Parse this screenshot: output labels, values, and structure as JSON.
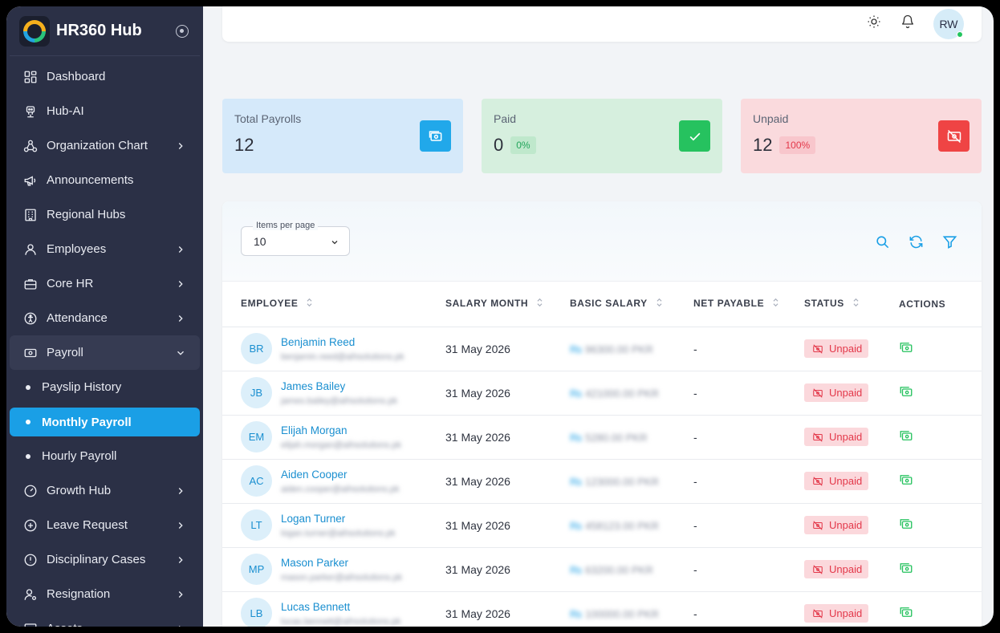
{
  "brand": {
    "name": "HR360 Hub"
  },
  "sidebar": {
    "items": [
      {
        "label": "Dashboard",
        "icon": "dashboard-icon",
        "chevron": false
      },
      {
        "label": "Hub-AI",
        "icon": "robot-icon",
        "chevron": false
      },
      {
        "label": "Organization Chart",
        "icon": "org-chart-icon",
        "chevron": true
      },
      {
        "label": "Announcements",
        "icon": "megaphone-icon",
        "chevron": false
      },
      {
        "label": "Regional Hubs",
        "icon": "building-icon",
        "chevron": false
      },
      {
        "label": "Employees",
        "icon": "user-icon",
        "chevron": true
      },
      {
        "label": "Core HR",
        "icon": "briefcase-icon",
        "chevron": true
      },
      {
        "label": "Attendance",
        "icon": "accessibility-icon",
        "chevron": true
      },
      {
        "label": "Payroll",
        "icon": "money-icon",
        "chevron": true,
        "open": true
      },
      {
        "label": "Growth Hub",
        "icon": "gauge-icon",
        "chevron": true
      },
      {
        "label": "Leave Request",
        "icon": "plus-circle-icon",
        "chevron": true
      },
      {
        "label": "Disciplinary Cases",
        "icon": "alert-circle-icon",
        "chevron": true
      },
      {
        "label": "Resignation",
        "icon": "user-settings-icon",
        "chevron": true
      },
      {
        "label": "Assets",
        "icon": "monitor-icon",
        "chevron": true
      }
    ],
    "payroll_sub": [
      {
        "label": "Payslip History",
        "active": false
      },
      {
        "label": "Monthly Payroll",
        "active": true
      },
      {
        "label": "Hourly Payroll",
        "active": false
      }
    ]
  },
  "topbar": {
    "avatar_initials": "RW"
  },
  "cards": {
    "total": {
      "title": "Total Payrolls",
      "value": "12"
    },
    "paid": {
      "title": "Paid",
      "value": "0",
      "badge": "0%"
    },
    "unpaid": {
      "title": "Unpaid",
      "value": "12",
      "badge": "100%"
    }
  },
  "table_controls": {
    "items_per_page_label": "Items per page",
    "items_per_page_value": "10"
  },
  "table": {
    "columns": [
      "EMPLOYEE",
      "SALARY MONTH",
      "BASIC SALARY",
      "NET PAYABLE",
      "STATUS",
      "ACTIONS"
    ],
    "rows": [
      {
        "initials": "BR",
        "name": "Benjamin Reed",
        "email": "benjamin.reed@aihsolutions.pk",
        "month": "31 May 2026",
        "salary": "96300.00 PKR",
        "net": "-",
        "status": "Unpaid"
      },
      {
        "initials": "JB",
        "name": "James Bailey",
        "email": "james.bailey@aihsolutions.pk",
        "month": "31 May 2026",
        "salary": "421000.00 PKR",
        "net": "-",
        "status": "Unpaid"
      },
      {
        "initials": "EM",
        "name": "Elijah Morgan",
        "email": "elijah.morgan@aihsolutions.pk",
        "month": "31 May 2026",
        "salary": "5280.00 PKR",
        "net": "-",
        "status": "Unpaid"
      },
      {
        "initials": "AC",
        "name": "Aiden Cooper",
        "email": "aiden.cooper@aihsolutions.pk",
        "month": "31 May 2026",
        "salary": "123000.00 PKR",
        "net": "-",
        "status": "Unpaid"
      },
      {
        "initials": "LT",
        "name": "Logan Turner",
        "email": "logan.turner@aihsolutions.pk",
        "month": "31 May 2026",
        "salary": "458123.00 PKR",
        "net": "-",
        "status": "Unpaid"
      },
      {
        "initials": "MP",
        "name": "Mason Parker",
        "email": "mason.parker@aihsolutions.pk",
        "month": "31 May 2026",
        "salary": "63200.00 PKR",
        "net": "-",
        "status": "Unpaid"
      },
      {
        "initials": "LB",
        "name": "Lucas Bennett",
        "email": "lucas.bennett@aihsolutions.pk",
        "month": "31 May 2026",
        "salary": "100000.00 PKR",
        "net": "-",
        "status": "Unpaid"
      }
    ]
  },
  "colors": {
    "sidebar_bg": "#2b3046",
    "accent": "#1a9fe6",
    "paid_green": "#26c25f",
    "unpaid_red": "#ef4444"
  }
}
